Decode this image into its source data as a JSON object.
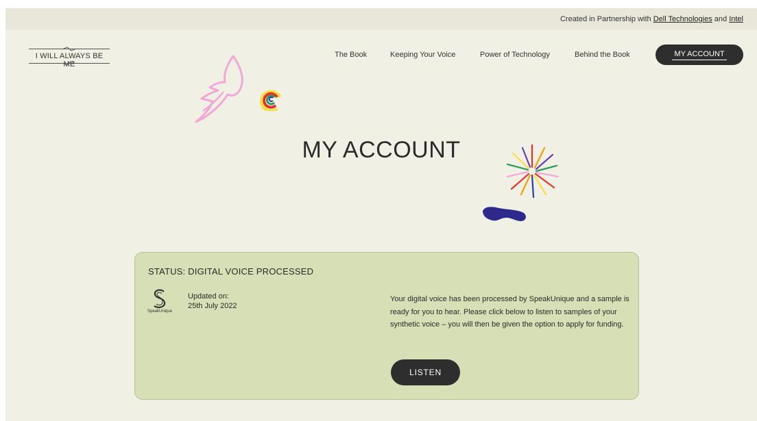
{
  "topbar": {
    "prefix": "Created in Partnership with ",
    "link1": "Dell Technologies",
    "conj": " and ",
    "link2": "Intel"
  },
  "logo": {
    "text": "I WILL ALWAYS BE ME"
  },
  "nav": {
    "items": [
      "The Book",
      "Keeping Your Voice",
      "Power of Technology",
      "Behind the Book"
    ],
    "account": "MY ACCOUNT"
  },
  "page": {
    "title": "MY ACCOUNT"
  },
  "card": {
    "status": "STATUS: DIGITAL VOICE PROCESSED",
    "brand": "SpeakUnique",
    "updated_label": "Updated on:",
    "updated_date": "25th July 2022",
    "description": "Your digital voice has been processed by SpeakUnique and a sample is ready for you to hear. Please click below to listen to samples of your synthetic voice – you will then be given the option to apply for funding.",
    "listen": "LISTEN"
  },
  "icons": [
    "bird-icon",
    "rainbow-icon",
    "starburst-icon",
    "paint-stroke-icon",
    "speakunique-logo-icon"
  ],
  "colors": {
    "background": "#f1f0e4",
    "card": "#d6dfb5",
    "button": "#2e2e2e"
  }
}
